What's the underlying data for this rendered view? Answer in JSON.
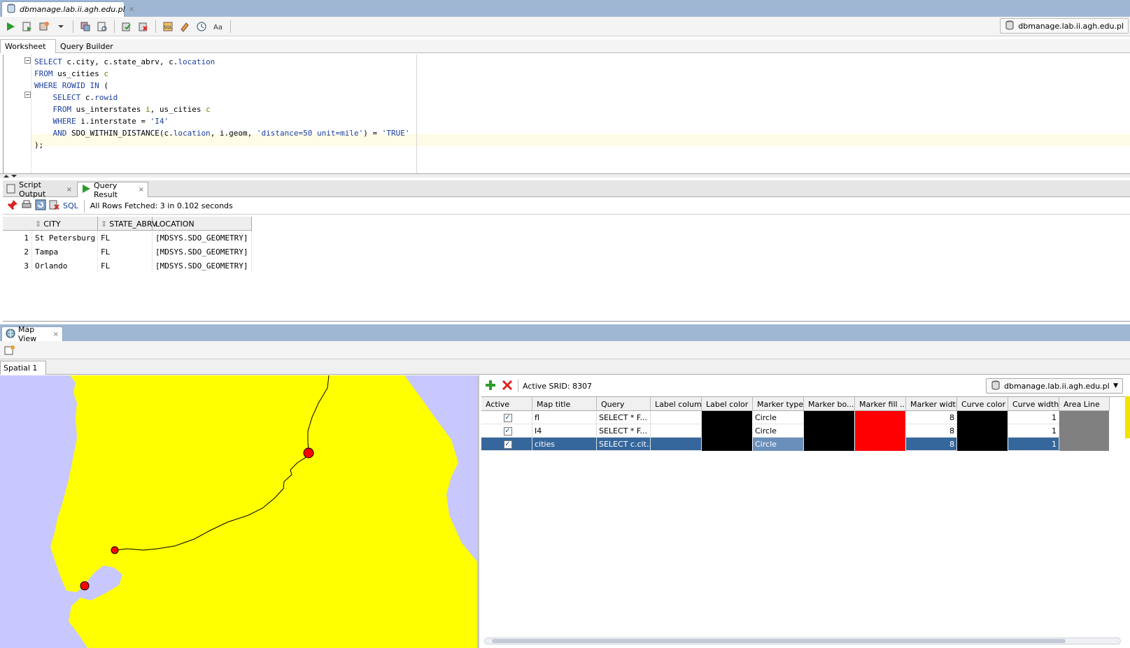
{
  "window": {
    "tab_title": "dbmanage.lab.ii.agh.edu.pl",
    "close": "×"
  },
  "toolbar": {
    "connection": "dbmanage.lab.ii.agh.edu.pl"
  },
  "worksheet_tabs": {
    "worksheet": "Worksheet",
    "query_builder": "Query Builder"
  },
  "editor": {
    "lines": [
      [
        "kw:SELECT",
        "txt: c.city, c.state_abrv, c.",
        "kw:location"
      ],
      [
        "kw:FROM",
        "txt: us_cities ",
        "lit:c"
      ],
      [
        "kw:WHERE ROWID IN",
        "txt: ("
      ],
      [
        "txt:    ",
        "kw:SELECT",
        "txt: c.",
        "kw:rowid"
      ],
      [
        "txt:    ",
        "kw:FROM",
        "txt: us_interstates ",
        "lit:i",
        "txt:, us_cities ",
        "lit:c"
      ],
      [
        "txt:    ",
        "kw:WHERE",
        "txt: i.interstate = ",
        "str:'I4'"
      ],
      [
        "txt:    ",
        "kw:AND",
        "txt: SDO_WITHIN_DISTANCE(c.",
        "kw:location",
        "txt:, i.geom, ",
        "str:'distance=50 unit=mile'",
        "txt:) = ",
        "str:'TRUE'"
      ],
      [
        "txt:);"
      ]
    ]
  },
  "results": {
    "tab_script": "Script Output",
    "tab_query": "Query Result",
    "close": "×",
    "sql_link": "SQL",
    "status": "All Rows Fetched: 3 in 0.102 seconds",
    "columns": [
      "CITY",
      "STATE_ABRV",
      "LOCATION"
    ],
    "rows": [
      {
        "n": "1",
        "city": "St Petersburg",
        "state": "FL",
        "loc": "[MDSYS.SDO_GEOMETRY]"
      },
      {
        "n": "2",
        "city": "Tampa",
        "state": "FL",
        "loc": "[MDSYS.SDO_GEOMETRY]"
      },
      {
        "n": "3",
        "city": "Orlando",
        "state": "FL",
        "loc": "[MDSYS.SDO_GEOMETRY]"
      }
    ]
  },
  "map": {
    "tab_title": "Map View",
    "close": "×",
    "spatial_tab": "Spatial 1",
    "colors": {
      "land": "#ffff00",
      "water": "#c8c8ff",
      "marker": "#ff0000",
      "road": "#000000"
    }
  },
  "layers": {
    "srid": "Active SRID: 8307",
    "connection": "dbmanage.lab.ii.agh.edu.pl",
    "columns": [
      "Active",
      "Map title",
      "Query",
      "Label column",
      "Label color",
      "Marker type",
      "Marker bo...",
      "Marker fill ...",
      "Marker width",
      "Curve color",
      "Curve width",
      "Area Line"
    ],
    "rows": [
      {
        "active": true,
        "title": "fl",
        "query": "SELECT * F...",
        "label_col": "",
        "label_color": "#000000",
        "marker_type": "Circle",
        "marker_border": "#000000",
        "marker_fill": "#ff0000",
        "marker_width": "8",
        "curve_color": "#000000",
        "curve_width": "1",
        "area_line": "#808080",
        "selected": false
      },
      {
        "active": true,
        "title": "I4",
        "query": "SELECT * F...",
        "label_col": "",
        "label_color": "#000000",
        "marker_type": "Circle",
        "marker_border": "#000000",
        "marker_fill": "#ff0000",
        "marker_width": "8",
        "curve_color": "#000000",
        "curve_width": "1",
        "area_line": "#808080",
        "selected": false
      },
      {
        "active": true,
        "title": "cities",
        "query": "SELECT c.cit...",
        "label_col": "",
        "label_color": "#000000",
        "marker_type": "Circle",
        "marker_border": "#000000",
        "marker_fill": "#ff0000",
        "marker_width": "8",
        "curve_color": "#000000",
        "curve_width": "1",
        "area_line": "#808080",
        "selected": true
      }
    ]
  }
}
